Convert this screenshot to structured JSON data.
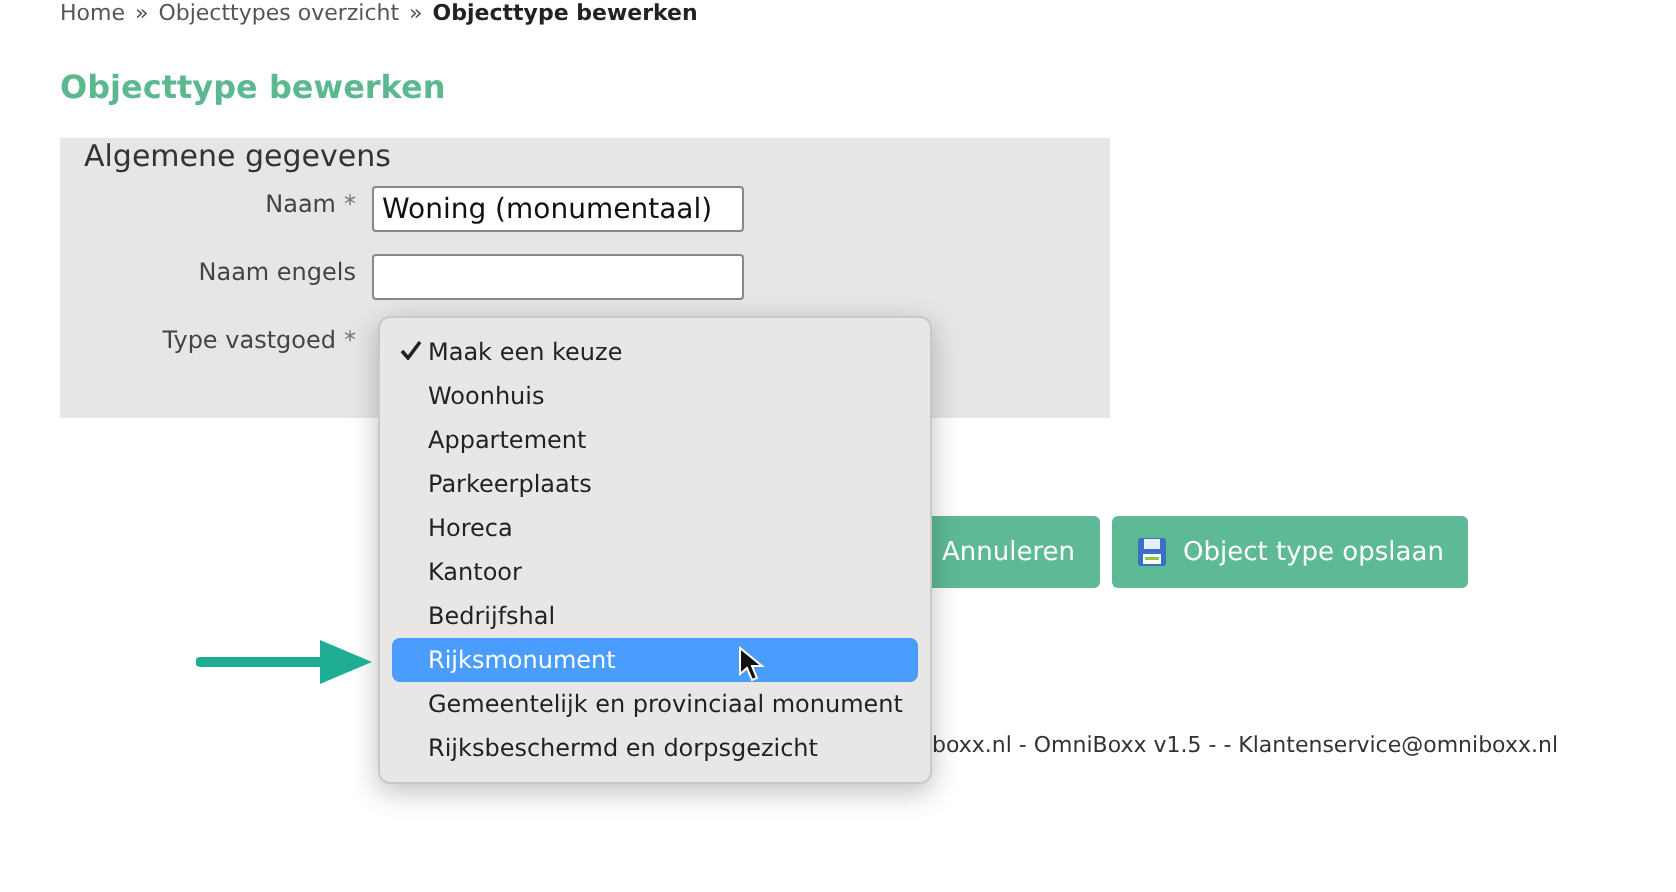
{
  "breadcrumb": {
    "separator": "»",
    "items": [
      {
        "label": "Home",
        "current": false
      },
      {
        "label": "Objecttypes overzicht",
        "current": false
      },
      {
        "label": "Objecttype bewerken",
        "current": true
      }
    ]
  },
  "page_title": "Objecttype bewerken",
  "fieldset": {
    "legend": "Algemene gegevens",
    "fields": [
      {
        "label": "Naam",
        "required_mark": "*",
        "kind": "text",
        "value": "Woning (monumentaal)"
      },
      {
        "label": "Naam engels",
        "kind": "text"
      },
      {
        "label": "Type vastgoed",
        "required_mark": "*",
        "kind": "select"
      }
    ]
  },
  "dropdown": {
    "options": [
      {
        "label": "Maak een keuze",
        "checked": true,
        "selected": false
      },
      {
        "label": "Woonhuis",
        "checked": false,
        "selected": false
      },
      {
        "label": "Appartement",
        "checked": false,
        "selected": false
      },
      {
        "label": "Parkeerplaats",
        "checked": false,
        "selected": false
      },
      {
        "label": "Horeca",
        "checked": false,
        "selected": false
      },
      {
        "label": "Kantoor",
        "checked": false,
        "selected": false
      },
      {
        "label": "Bedrijfshal",
        "checked": false,
        "selected": false
      },
      {
        "label": "Rijksmonument",
        "checked": false,
        "selected": true
      },
      {
        "label": "Gemeentelijk en provinciaal monument",
        "checked": false,
        "selected": false
      },
      {
        "label": "Rijksbeschermd en dorpsgezicht",
        "checked": false,
        "selected": false
      }
    ]
  },
  "buttons": [
    {
      "label": "Annuleren",
      "kind": "cancel"
    },
    {
      "label": "Object type opslaan",
      "kind": "save"
    }
  ],
  "footer": "boxx.nl - OmniBoxx v1.5 - - Klantenservice@omniboxx.nl"
}
